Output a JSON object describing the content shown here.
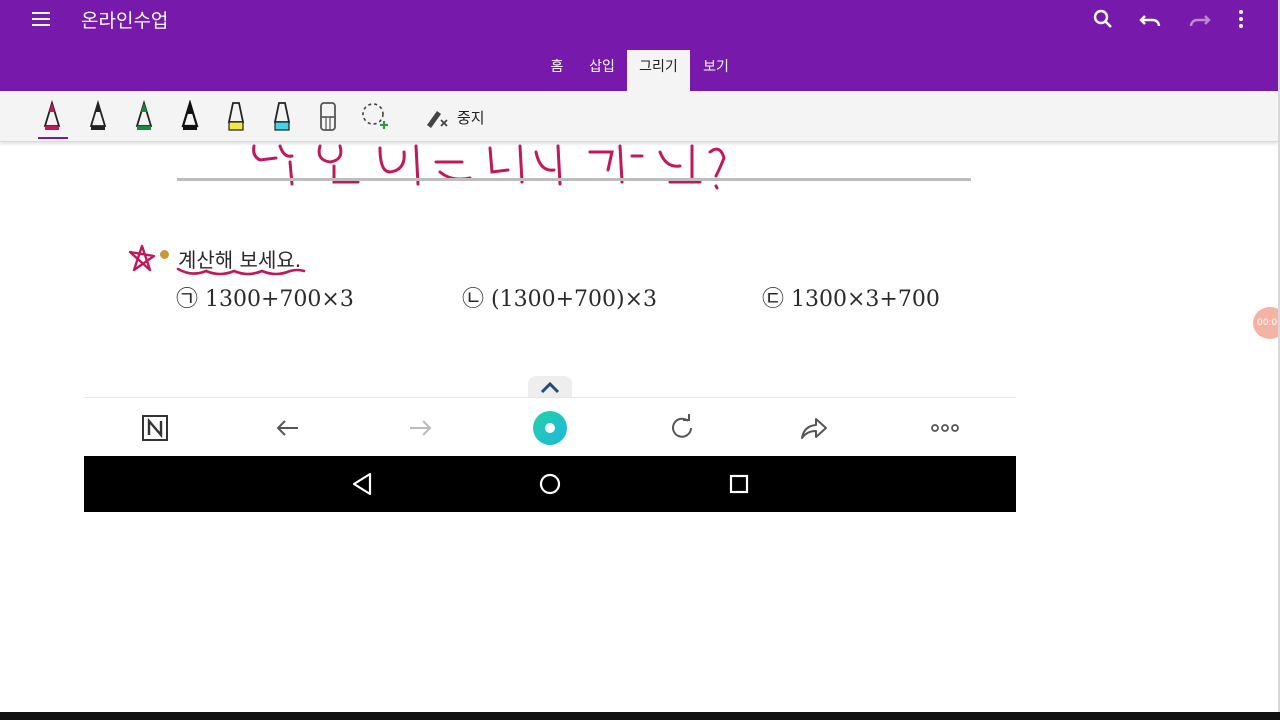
{
  "app": {
    "title": "온라인수업"
  },
  "tabs": [
    {
      "label": "홈"
    },
    {
      "label": "삽입"
    },
    {
      "label": "그리기",
      "active": true
    },
    {
      "label": "보기"
    }
  ],
  "ribbon": {
    "tools": [
      {
        "icon": "pen-magenta-icon",
        "color": "#c2185b",
        "selected": true
      },
      {
        "icon": "pen-black-icon",
        "color": "#222222"
      },
      {
        "icon": "pen-green-icon",
        "color": "#1b8a3a"
      },
      {
        "icon": "pen-black-bold-icon",
        "color": "#111111"
      },
      {
        "icon": "highlighter-yellow-icon",
        "color": "#f4e842"
      },
      {
        "icon": "highlighter-cyan-icon",
        "color": "#3fd4e6"
      },
      {
        "icon": "eraser-icon",
        "color": "#777777"
      },
      {
        "icon": "lasso-select-icon",
        "color": "#2e9b3c"
      }
    ],
    "stop_label": "중지"
  },
  "content": {
    "instruction": "계산해 보세요.",
    "problems": [
      "㉠ 1300+700×3",
      "㉡ (1300+700)×3",
      "㉢ 1300×3+700"
    ]
  },
  "recording": {
    "time": "00:0"
  },
  "browser_bar": {
    "icons": [
      "n-logo-icon",
      "back-arrow-icon",
      "forward-arrow-icon",
      "green-circle-icon",
      "refresh-icon",
      "share-icon",
      "more-icon"
    ]
  },
  "android_nav": {
    "icons": [
      "back-triangle-icon",
      "home-circle-icon",
      "recents-square-icon"
    ]
  },
  "colors": {
    "accent": "#7719aa",
    "ink": "#c2185b"
  }
}
